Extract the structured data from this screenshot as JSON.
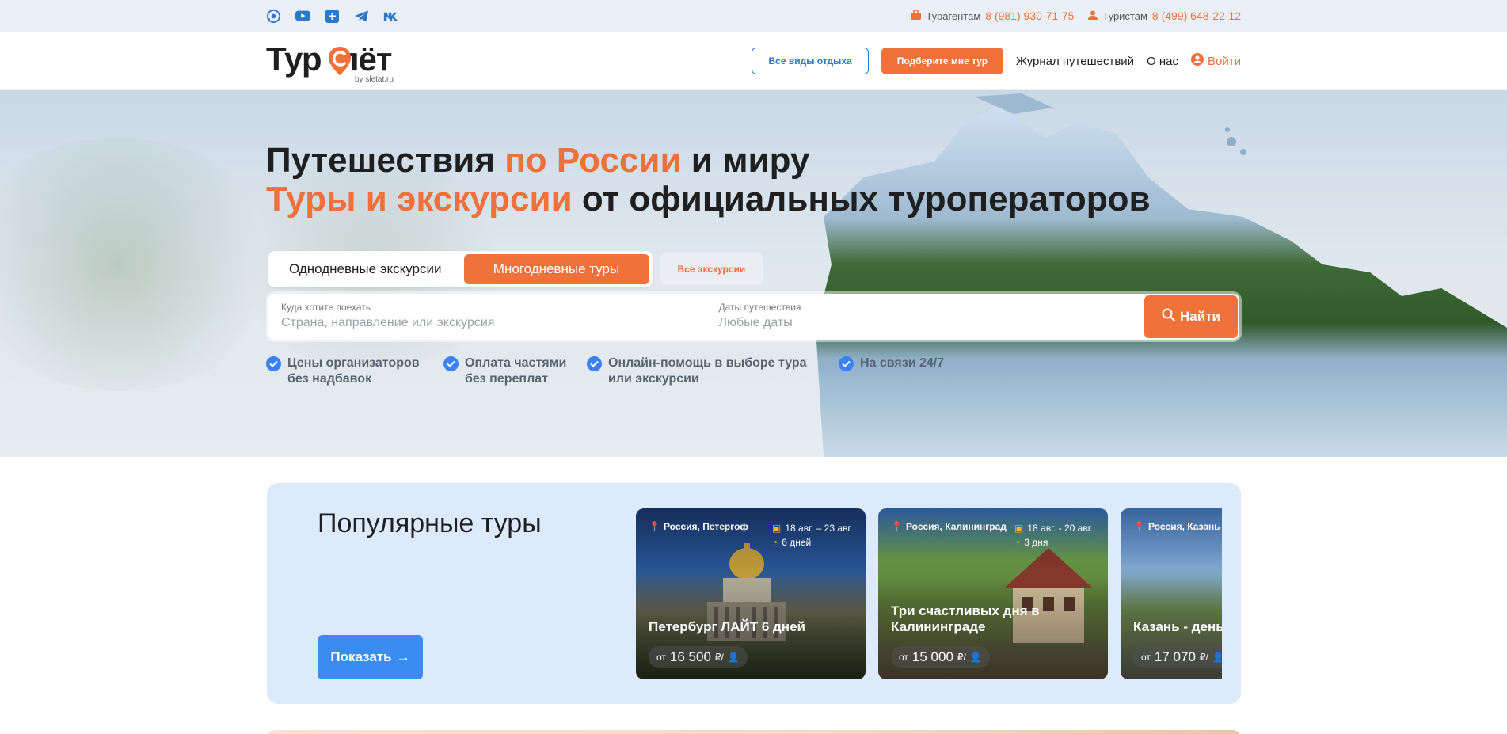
{
  "topbar": {
    "socials": [
      "whatsapp-icon",
      "youtube-icon",
      "plus-icon",
      "telegram-icon",
      "vk-icon"
    ],
    "contacts": [
      {
        "label": "Турагентам",
        "phone": "8 (981) 930-71-75"
      },
      {
        "label": "Туристам",
        "phone": "8 (499) 648-22-12"
      }
    ]
  },
  "header": {
    "logo_text": "Тур  лёт",
    "logo_sub": "by sletat.ru",
    "btn_all": "Все виды отдыха",
    "btn_pick": "Подберите мне тур",
    "link_journal": "Журнал путешествий",
    "link_about": "О нас",
    "login": "Войти"
  },
  "hero": {
    "title_line1_a": "Путешествия ",
    "title_line1_b": "по России",
    "title_line1_c": " и миру",
    "title_line2_a": "Туры и экскурсии",
    "title_line2_b": " от официальных туроператоров",
    "tabs": [
      "Однодневные экскурсии",
      "Многодневные туры"
    ],
    "tab_all": "Все экскурсии",
    "search": {
      "where_label": "Куда хотите поехать",
      "where_placeholder": "Страна, направление или экскурсия",
      "dates_label": "Даты путешествия",
      "dates_value": "Любые даты",
      "button": "Найти"
    },
    "benefits": [
      {
        "l1": "Цены организаторов",
        "l2": "без надбавок"
      },
      {
        "l1": "Оплата частями",
        "l2": "без переплат"
      },
      {
        "l1": "Онлайн-помощь в выборе тура",
        "l2": "или экскурсии"
      },
      {
        "l1": "На связи 24/7",
        "l2": ""
      }
    ]
  },
  "popular": {
    "title": "Популярные туры",
    "show": "Показать",
    "cards": [
      {
        "location": "Россия, Петергоф",
        "dates": "18 авг. – 23 авг.",
        "duration": "6 дней",
        "name": "Петербург ЛАЙТ 6 дней",
        "from": "от",
        "price": "16 500",
        "unit": "₽/"
      },
      {
        "location": "Россия, Калининград",
        "dates": "18 авг. - 20 авг.",
        "duration": "3 дня",
        "name": "Три счастливых дня в Калининграде",
        "from": "от",
        "price": "15 000",
        "unit": "₽/"
      },
      {
        "location": "Россия, Казань",
        "dates": "",
        "duration": "",
        "name": "Казань - день",
        "from": "от",
        "price": "17 070",
        "unit": "₽/"
      }
    ]
  },
  "colors": {
    "accent": "#f2703a",
    "blue": "#3b8cf0",
    "section_bg": "#dceafb"
  }
}
